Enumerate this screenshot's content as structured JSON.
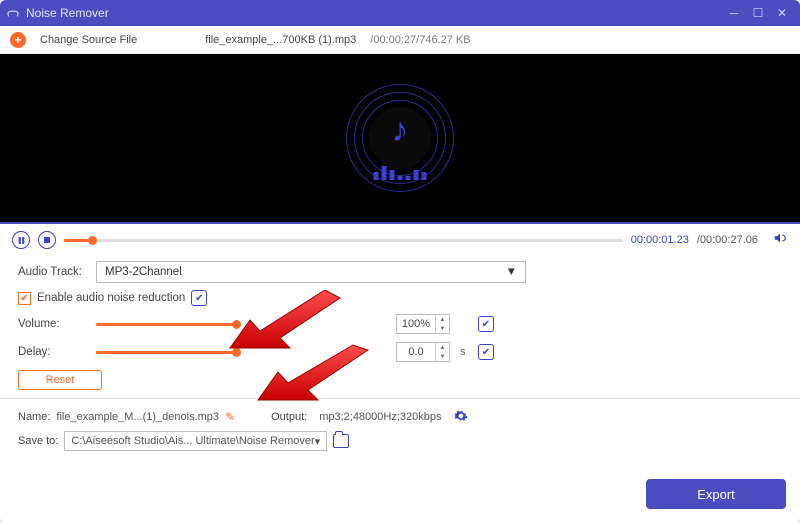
{
  "titlebar": {
    "appname": "Noise Remover"
  },
  "filebar": {
    "change_label": "Change Source File",
    "filename": "file_example_...700KB (1).mp3",
    "separator": "/",
    "metadata": "00:00:27/746.27 KB"
  },
  "player": {
    "elapsed": "00:00:01.23",
    "total": "/00:00:27.06",
    "progress_pct": 5
  },
  "panel": {
    "audiotrack_label": "Audio Track:",
    "audiotrack_value": "MP3-2Channel",
    "enable_label": "Enable audio noise reduction",
    "volume_label": "Volume:",
    "volume_value": "100%",
    "volume_pct": 100,
    "delay_label": "Delay:",
    "delay_value": "0.0",
    "delay_pct": 100,
    "delay_unit": "s",
    "reset_label": "Reset"
  },
  "bottom": {
    "name_label": "Name:",
    "name_value": "file_example_M...(1)_denois.mp3",
    "output_label": "Output:",
    "output_value": "mp3;2;48000Hz;320kbps",
    "saveto_label": "Save to:",
    "saveto_value": "C:\\Aiseesoft Studio\\Ais... Ultimate\\Noise Remover",
    "export_label": "Export"
  }
}
